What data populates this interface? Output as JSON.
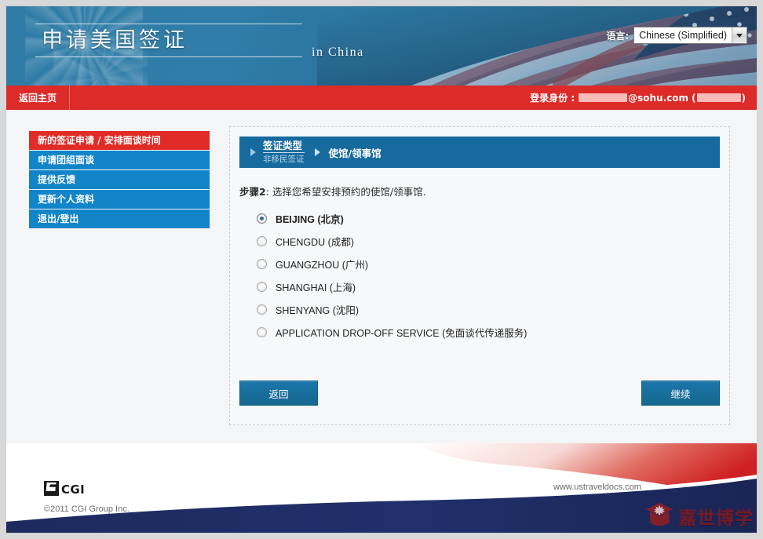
{
  "header": {
    "title": "申请美国签证",
    "subtitle": "in  China",
    "language_label": "语言:",
    "language_value": "Chinese (Simplified)",
    "dropdown_icon": "chevron-down-icon",
    "flag_icon": "us-flag-image",
    "fireworks_icon": "fireworks-burst-decoration"
  },
  "nav": {
    "home_label": "返回主页",
    "login_prefix": "登录身份 :",
    "login_email_domain": "@sohu.com",
    "login_paren_open": "(",
    "login_paren_close": ")"
  },
  "sidebar": {
    "items": [
      {
        "label": "新的签证申请 / 安排面谈时间",
        "active": true
      },
      {
        "label": "申请团组面谈",
        "active": false
      },
      {
        "label": "提供反馈",
        "active": false
      },
      {
        "label": "更新个人资料",
        "active": false
      },
      {
        "label": "退出/登出",
        "active": false
      }
    ]
  },
  "main": {
    "breadcrumb": {
      "step1_label": "签证类型",
      "step1_sub": "非移民签证",
      "step2_label": "使馆/领事馆",
      "arrow_icon": "triangle-right-icon"
    },
    "step_prefix": "步骤2",
    "step_text": ": 选择您希望安排预约的使馆/领事馆.",
    "options": [
      {
        "label": "BEIJING (北京)",
        "selected": true
      },
      {
        "label": "CHENGDU (成都)",
        "selected": false
      },
      {
        "label": "GUANGZHOU (广州)",
        "selected": false
      },
      {
        "label": "SHANGHAI (上海)",
        "selected": false
      },
      {
        "label": "SHENYANG (沈阳)",
        "selected": false
      },
      {
        "label": "APPLICATION DROP-OFF SERVICE (免面谈代传递服务)",
        "selected": false
      }
    ],
    "back_button": "返回",
    "continue_button": "继续"
  },
  "footer": {
    "logo_text": "CGI",
    "logo_icon": "cgi-logo-icon",
    "copyright": "©2011 CGI Group Inc.",
    "site_url": "www.ustraveldocs.com",
    "watermark_text": "嘉世博学",
    "watermark_icon": "graduation-cap-maple-leaf-icon"
  },
  "colors": {
    "red_nav": "#dc2b28",
    "sidebar_blue": "#1284c8",
    "sidebar_active_red": "#e02b26",
    "breadcrumb_blue": "#166a9e",
    "button_blue": "#15688f",
    "footer_navy": "#1f2d63",
    "watermark_red": "#7e1922"
  }
}
